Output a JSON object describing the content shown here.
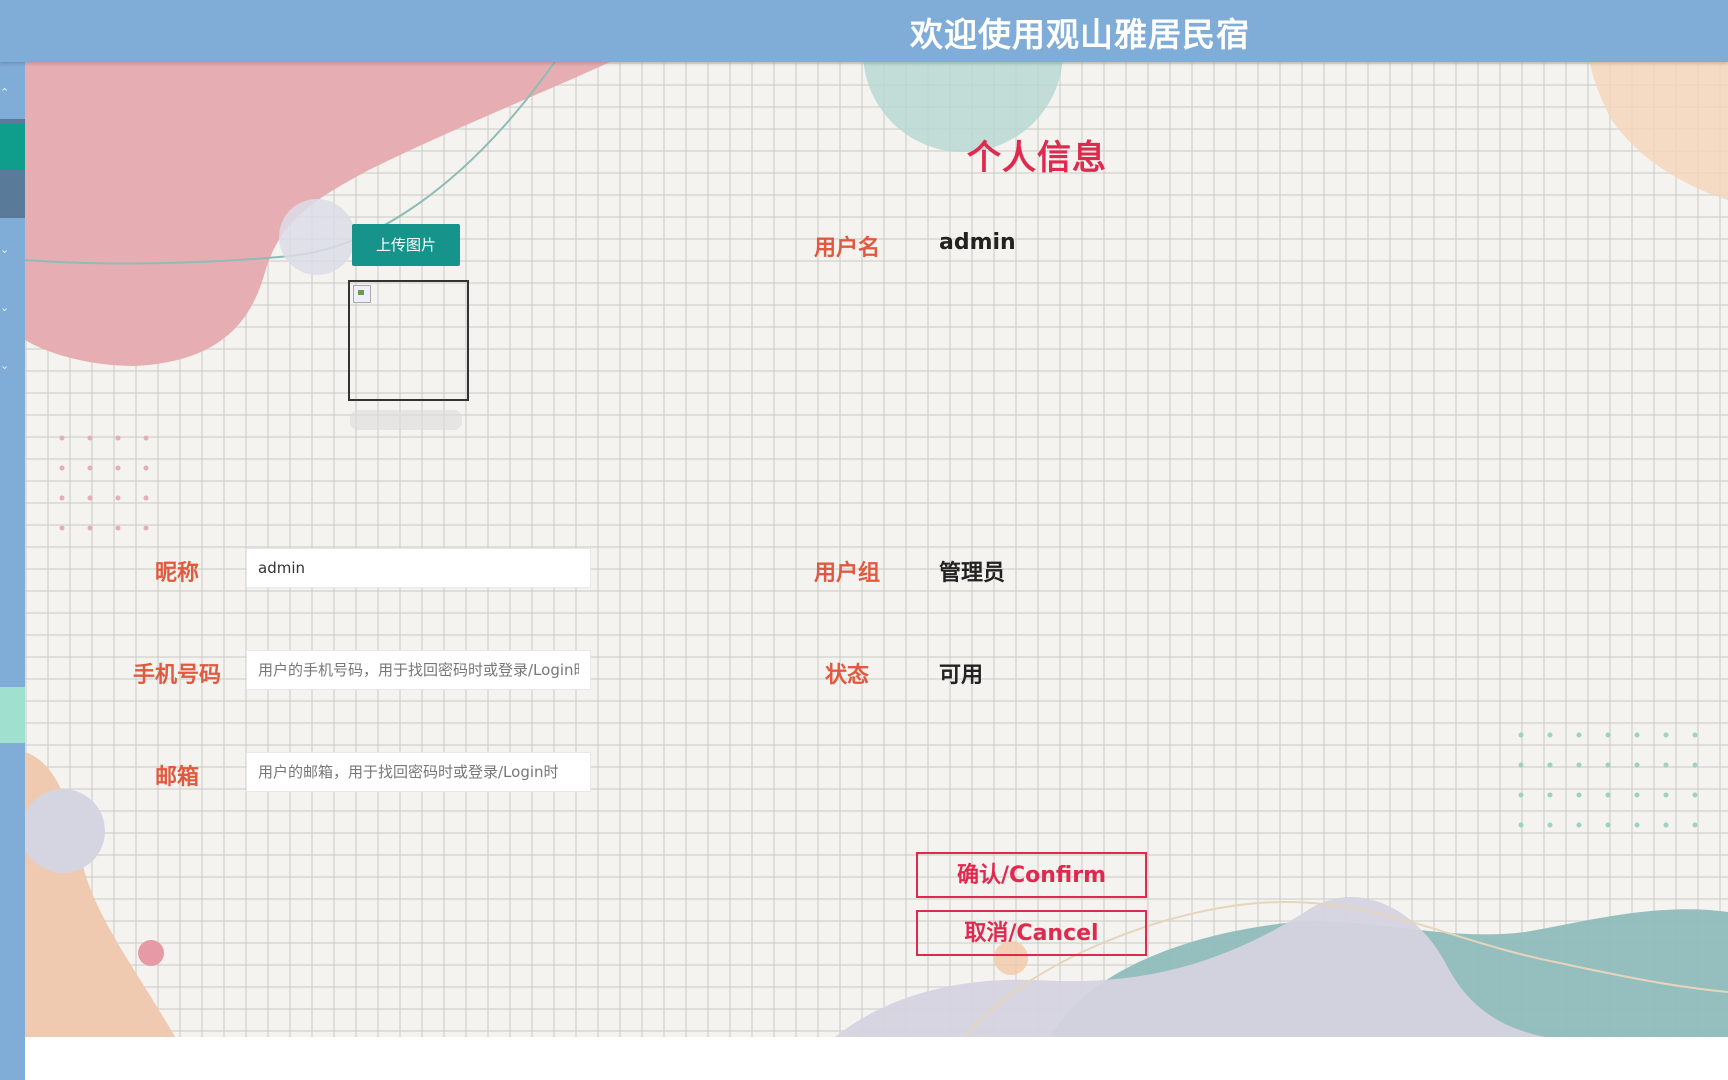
{
  "header": {
    "title": "欢迎使用观山雅居民宿"
  },
  "sidebar": {
    "active_color": "#0f9d8c",
    "accent_color": "#9fe0cf",
    "items": [
      "chevron-up-icon",
      "chevron-down-icon",
      "chevron-down-icon",
      "chevron-down-icon"
    ]
  },
  "page": {
    "heading": "个人信息"
  },
  "avatar": {
    "upload_label": "上传图片"
  },
  "fields": {
    "username": {
      "label": "用户名",
      "value": "admin"
    },
    "nickname": {
      "label": "昵称",
      "value": "admin"
    },
    "group": {
      "label": "用户组",
      "value": "管理员"
    },
    "phone": {
      "label": "手机号码",
      "placeholder": "用户的手机号码，用于找回密码时或登录/Login时"
    },
    "status": {
      "label": "状态",
      "value": "可用"
    },
    "email": {
      "label": "邮箱",
      "placeholder": "用户的邮箱，用于找回密码时或登录/Login时"
    }
  },
  "actions": {
    "confirm_label": "确认/Confirm",
    "cancel_label": "取消/Cancel"
  },
  "colors": {
    "header_bg": "#80acd8",
    "heading": "#e0294f",
    "label": "#e05a40",
    "upload_btn": "#16938a"
  }
}
